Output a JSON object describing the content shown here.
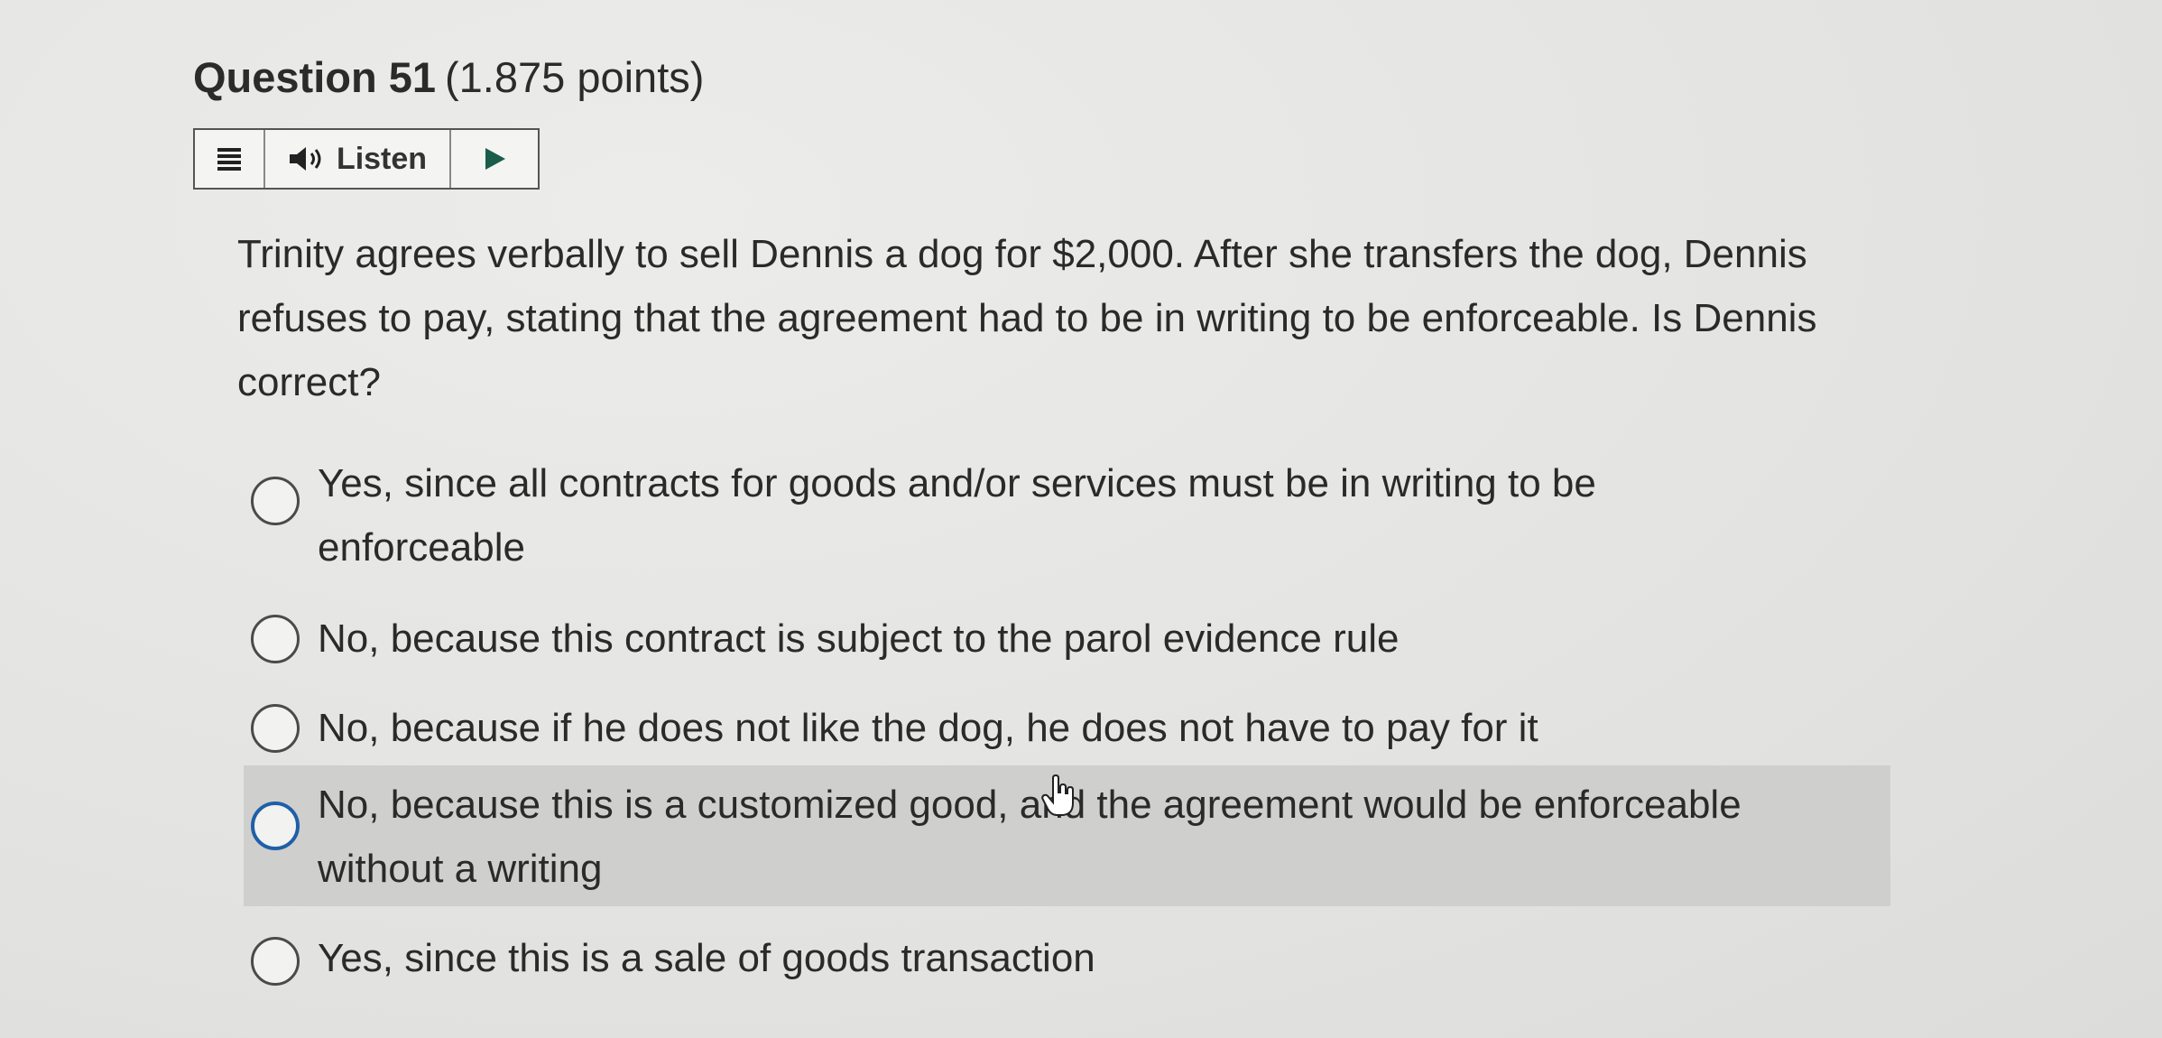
{
  "question": {
    "number_label": "Question 51",
    "points": "(1.875 points)",
    "text": "Trinity agrees verbally to sell Dennis a dog for $2,000. After she transfers the dog, Dennis refuses to pay, stating that the agreement had to be in writing to be enforceable. Is Dennis correct?"
  },
  "toolbar": {
    "menu_icon": "menu-lines-icon",
    "listen_icon": "speaker-icon",
    "listen_label": "Listen",
    "play_icon": "play-icon"
  },
  "options": [
    {
      "label": "Yes, since all contracts for goods and/or services must be in writing to be enforceable",
      "selected": false,
      "highlighted": false
    },
    {
      "label": "No, because this contract is subject to the parol evidence rule",
      "selected": false,
      "highlighted": false
    },
    {
      "label": "No, because if he does not like the dog, he does not have to pay for it",
      "selected": false,
      "highlighted": false
    },
    {
      "label": "No, because this is a customized good, and the agreement would be enforceable without a writing",
      "selected": false,
      "highlighted": true
    },
    {
      "label": "Yes, since this is a sale of goods transaction",
      "selected": false,
      "highlighted": false
    }
  ],
  "colors": {
    "highlight_bg": "#cfcfcd",
    "focus_ring": "#1f5fa8",
    "text": "#2a2a2a"
  }
}
